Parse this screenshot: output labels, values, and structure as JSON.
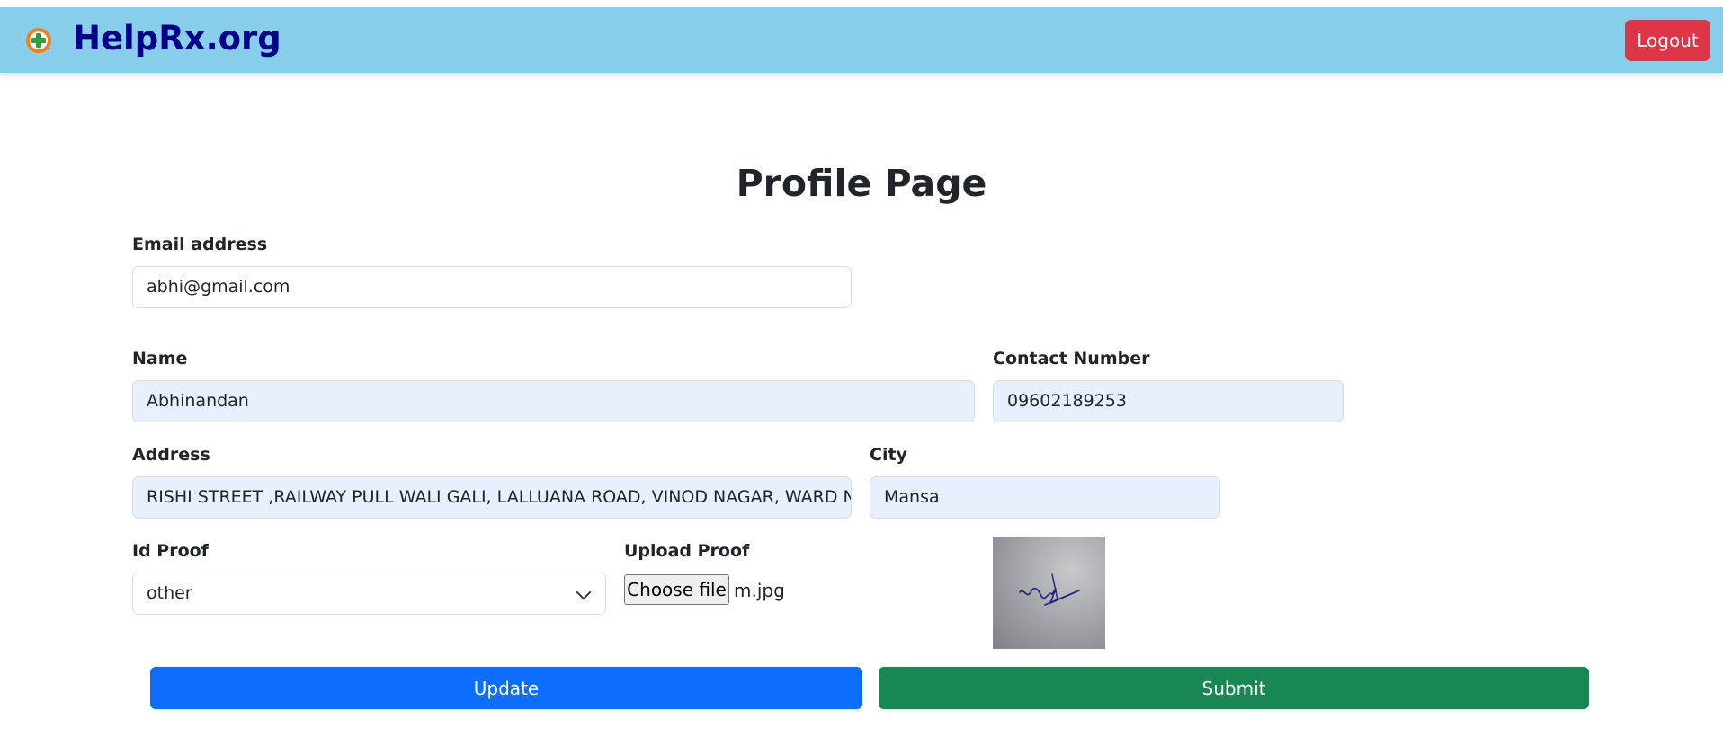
{
  "navbar": {
    "brand": "HelpRx.org",
    "logout_label": "Logout"
  },
  "page": {
    "title": "Profile Page"
  },
  "form": {
    "email": {
      "label": "Email address",
      "value": "abhi@gmail.com"
    },
    "name": {
      "label": "Name",
      "value": "Abhinandan"
    },
    "contact": {
      "label": "Contact Number",
      "value": "09602189253"
    },
    "address": {
      "label": "Address",
      "value": "RISHI STREET ,RAILWAY PULL WALI GALI, LALLUANA ROAD, VINOD NAGAR, WARD NO."
    },
    "city": {
      "label": "City",
      "value": "Mansa"
    },
    "id_proof": {
      "label": "Id Proof",
      "selected": "other"
    },
    "upload": {
      "label": "Upload Proof",
      "button_label": "Choose file",
      "file_name": "m.jpg"
    }
  },
  "actions": {
    "update_label": "Update",
    "submit_label": "Submit"
  },
  "colors": {
    "navbar_bg": "#87ceeb",
    "brand": "#00008b",
    "logout": "#dc3545",
    "update": "#0d6efd",
    "submit": "#198754",
    "autofill_bg": "#e8f0fe"
  },
  "icons": {
    "brand": "medical-cross-icon",
    "select": "chevron-down-icon"
  }
}
